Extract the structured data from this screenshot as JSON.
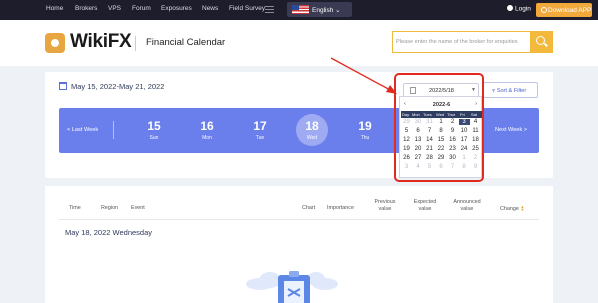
{
  "topnav": {
    "items": [
      "Home",
      "Brokers",
      "VPS",
      "Forum",
      "Exposures",
      "News",
      "Field Survey"
    ],
    "language": "English",
    "login": "Login",
    "download": "Download APP"
  },
  "header": {
    "logo": "WikiFX",
    "title": "Financial Calendar",
    "search_placeholder": "Please enter the name of the broker for enquiries"
  },
  "calendar": {
    "range": "May 15, 2022-May 21, 2022",
    "date_value": "2022/5/18",
    "sort_filter": "Sort & Filter",
    "last_week": "< Last Week",
    "next_week": "Next Week >",
    "days": [
      {
        "num": "15",
        "dow": "Sun"
      },
      {
        "num": "16",
        "dow": "Mon"
      },
      {
        "num": "17",
        "dow": "Tue"
      },
      {
        "num": "18",
        "dow": "Wed"
      },
      {
        "num": "19",
        "dow": "Thu"
      }
    ],
    "selected_index": 3
  },
  "picker": {
    "month": "2022-6",
    "prev": "‹",
    "next": "›",
    "weekdays": [
      "Day",
      "Mon",
      "Tues",
      "Wed",
      "Thur",
      "Fri",
      "Sat"
    ],
    "weeks": [
      [
        "29",
        "30",
        "31",
        "1",
        "2",
        "3",
        "4"
      ],
      [
        "5",
        "6",
        "7",
        "8",
        "9",
        "10",
        "11"
      ],
      [
        "12",
        "13",
        "14",
        "15",
        "16",
        "17",
        "18"
      ],
      [
        "19",
        "20",
        "21",
        "22",
        "23",
        "24",
        "25"
      ],
      [
        "26",
        "27",
        "28",
        "29",
        "30",
        "1",
        "2"
      ],
      [
        "3",
        "4",
        "5",
        "6",
        "7",
        "8",
        "9"
      ]
    ],
    "selected_day": "3"
  },
  "table": {
    "headers": [
      "Time",
      "Region",
      "Event",
      "Chart",
      "Importance",
      "Previous value",
      "Expected value",
      "Announced value",
      "Change"
    ],
    "section_date": "May 18, 2022 Wednesday"
  },
  "colors": {
    "accent": "#6a7fec",
    "brand": "#f2b93d",
    "annotation": "#e02b20"
  }
}
